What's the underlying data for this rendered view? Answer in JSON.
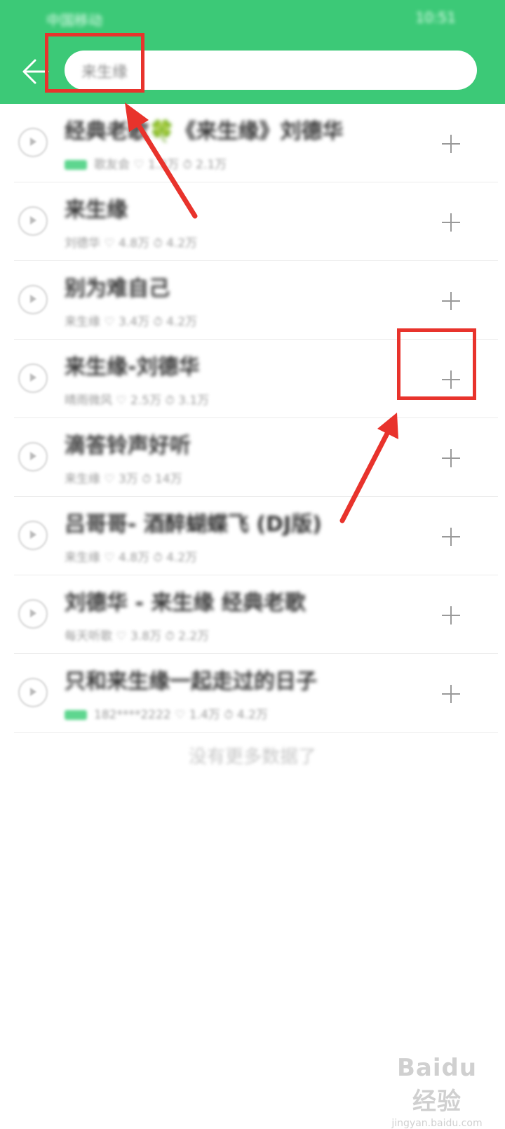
{
  "status_bar": {
    "carrier": "中国移动",
    "right": "10:51"
  },
  "search": {
    "value": "来生缘"
  },
  "songs": [
    {
      "title": "经典老歌🍀《来生缘》刘德华",
      "meta": "歌友会  ♡ 1.3万  ⏱ 2.1万",
      "tag": true
    },
    {
      "title": "来生缘",
      "meta": "刘德华  ♡ 4.8万  ⏱ 4.2万",
      "tag": false
    },
    {
      "title": "别为难自己",
      "meta": "来生缘  ♡ 3.4万  ⏱ 4.2万",
      "tag": false
    },
    {
      "title": "来生缘-刘德华",
      "meta": "晴雨微风  ♡ 2.5万  ⏱ 3.1万",
      "tag": false
    },
    {
      "title": "滴答铃声好听",
      "meta": "来生缘  ♡ 3万  ⏱ 14万",
      "tag": false
    },
    {
      "title": "吕哥哥- 酒醉蝴蝶飞 (DJ版)",
      "meta": "来生缘  ♡ 4.8万  ⏱ 4.2万",
      "tag": false
    },
    {
      "title": "刘德华 - 来生缘 经典老歌",
      "meta": "每天听歌  ♡ 3.8万  ⏱ 2.2万",
      "tag": false
    },
    {
      "title": "只和来生缘一起走过的日子",
      "meta": "182****2222  ♡ 1.4万  ⏱ 4.2万",
      "tag": true
    }
  ],
  "footer": {
    "end_text": "没有更多数据了"
  },
  "watermark": {
    "main": "Baidu 经验",
    "sub": "jingyan.baidu.com"
  },
  "colors": {
    "header": "#3cc977",
    "annotation": "#e8332c",
    "tag": "#5ed68f"
  },
  "icons": {
    "back": "back-arrow-icon",
    "play": "play-icon",
    "add": "plus-icon"
  }
}
